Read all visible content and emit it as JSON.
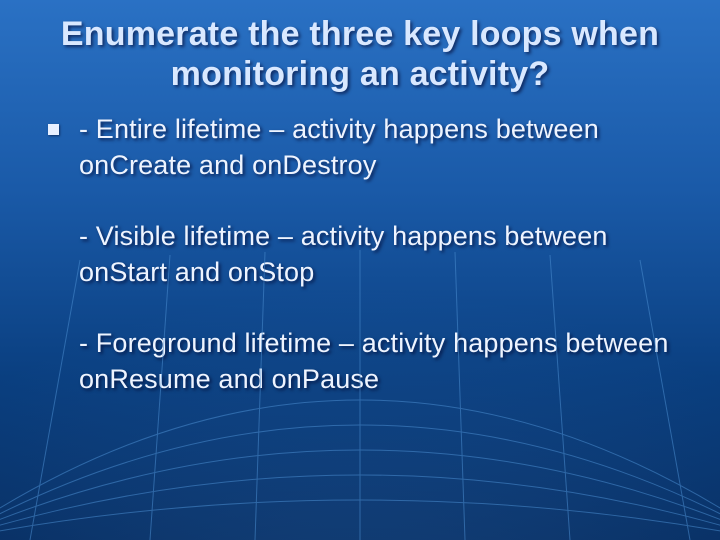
{
  "slide": {
    "title": "Enumerate the three key loops when monitoring an activity?",
    "bullet_text": "- Entire lifetime – activity happens between onCreate and onDestroy\n\n- Visible lifetime – activity happens between onStart and onStop\n\n- Foreground lifetime – activity happens between onResume and onPause"
  }
}
